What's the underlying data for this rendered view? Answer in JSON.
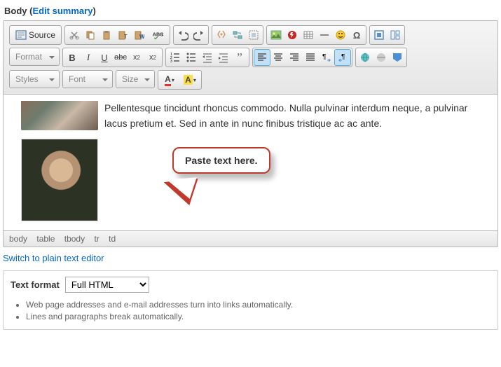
{
  "label": {
    "body": "Body",
    "edit_summary": "Edit summary"
  },
  "toolbar": {
    "source": "Source",
    "combos": {
      "format": "Format",
      "styles": "Styles",
      "font": "Font",
      "size": "Size"
    }
  },
  "content": {
    "text": "Pellentesque tincidunt rhoncus commodo. Nulla pulvinar interdum neque, a pulvinar lacus pretium et. Sed in ante in nunc finibus tristique ac ac ante."
  },
  "callout": {
    "text": "Paste text here."
  },
  "path": {
    "body": "body",
    "table": "table",
    "tbody": "tbody",
    "tr": "tr",
    "td": "td"
  },
  "switch_link": "Switch to plain text editor",
  "format": {
    "label": "Text format",
    "selected": "Full HTML",
    "tips": [
      "Web page addresses and e-mail addresses turn into links automatically.",
      "Lines and paragraphs break automatically."
    ]
  }
}
